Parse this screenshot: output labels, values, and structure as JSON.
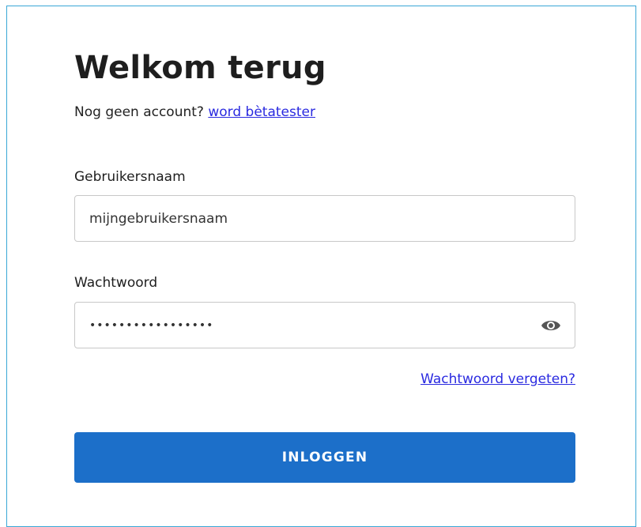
{
  "login": {
    "title": "Welkom terug",
    "subtitle_text": "Nog geen account?",
    "signup_link": "word bètatester",
    "username_label": "Gebruikersnaam",
    "username_value": "mijngebruikersnaam",
    "password_label": "Wachtwoord",
    "password_value": "•••••••••••••••••",
    "show_password_icon": "eye-icon",
    "forgot_link": "Wachtwoord vergeten?",
    "submit_label": "INLOGGEN"
  },
  "colors": {
    "accent": "#1c6fc9",
    "link": "#2a2ae0",
    "frame_border": "#3aa7d6"
  }
}
